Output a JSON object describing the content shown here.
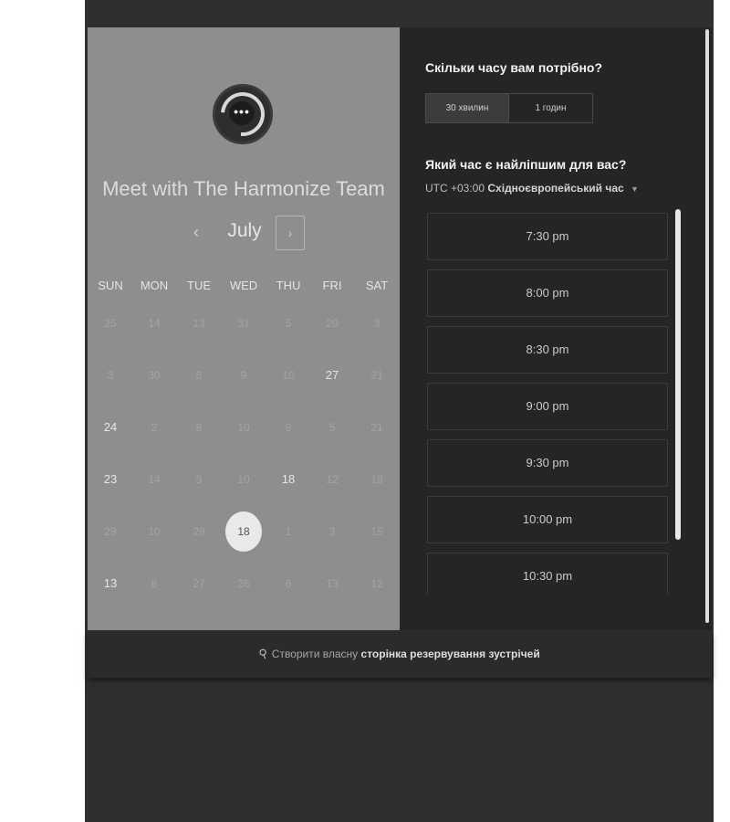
{
  "header": {
    "team_name": "Meet with The Harmonize Team"
  },
  "calendar": {
    "month": "July",
    "prev_icon": "‹",
    "next_icon": "›",
    "weekdays": [
      "SUN",
      "MON",
      "TUE",
      "WED",
      "THU",
      "FRI",
      "SAT"
    ],
    "weeks": [
      [
        "25",
        "14",
        "13",
        "31",
        "5",
        "20",
        "3"
      ],
      [
        "3",
        "30",
        "8",
        "9",
        "10",
        "27",
        "21"
      ],
      [
        "24",
        "2",
        "8",
        "10",
        "9",
        "5",
        "21"
      ],
      [
        "23",
        "14",
        "3",
        "10",
        "18",
        "12",
        "18"
      ],
      [
        "29",
        "10",
        "29",
        "18",
        "1",
        "3",
        "15"
      ],
      [
        "13",
        "8",
        "27",
        "26",
        "6",
        "13",
        "12"
      ]
    ],
    "available_days": [
      "27",
      "24",
      "23",
      "18",
      "13"
    ],
    "selected_day": "18"
  },
  "booking": {
    "duration_question": "Скільки часу вам потрібно?",
    "durations": [
      "30 хвилин",
      "1 годин"
    ],
    "active_duration": "30 хвилин",
    "time_question": "Який час є найліпшим для вас?",
    "timezone_prefix": "UTC +03:00",
    "timezone_name": "Східноєвропейський час",
    "slots": [
      "7:30 pm",
      "8:00 pm",
      "8:30 pm",
      "9:00 pm",
      "9:30 pm",
      "10:00 pm",
      "10:30 pm"
    ]
  },
  "footer": {
    "prefix": "Створити власну",
    "link": "сторінка резервування зустрічей"
  },
  "icons": {
    "avatar": "chat-bubble-icon",
    "footer": "hubspot-sprocket-icon",
    "timezone_caret": "caret-down-icon"
  }
}
